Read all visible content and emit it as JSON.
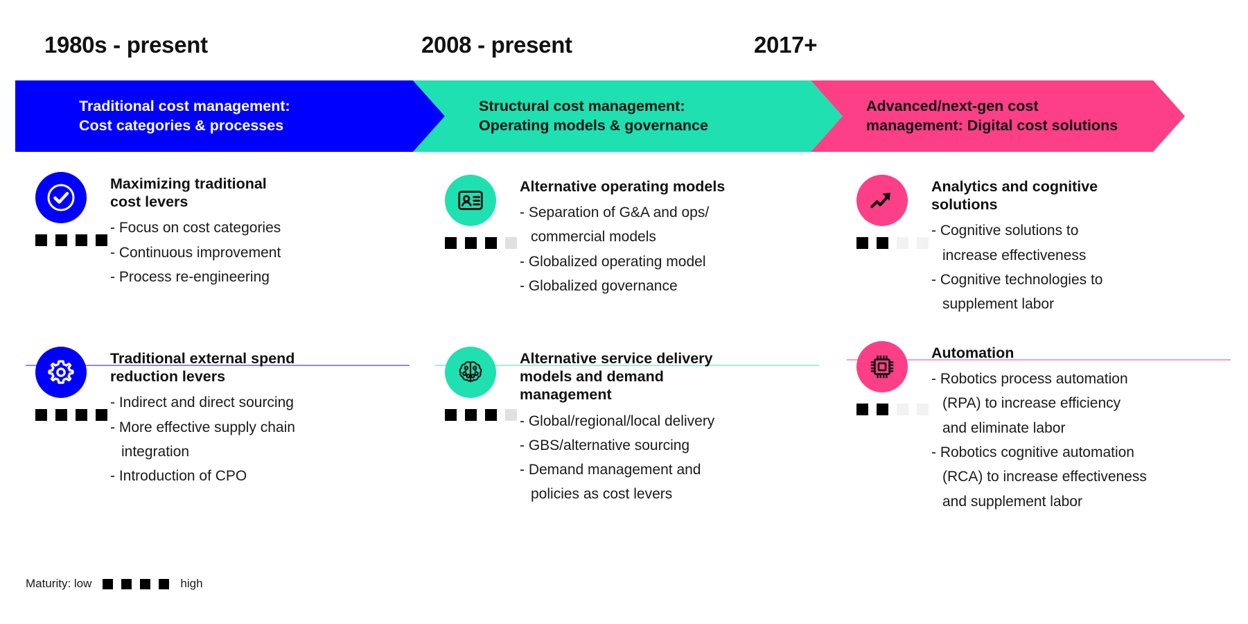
{
  "colors": {
    "blue": "#0000ff",
    "teal": "#1fe0b0",
    "pink": "#fc3f86",
    "maturity_filled": "#000000",
    "maturity_empty_teal": "#e0e0e0",
    "maturity_empty_pink": "#f2f2f2",
    "divider_blue": "#8a8aec",
    "divider_teal": "#a4ecd9",
    "divider_pink": "#f7a0bf"
  },
  "columns": [
    {
      "era": "1980s - present",
      "banner": "Traditional cost management:\nCost categories & processes",
      "banner_text_color": "#ffffff",
      "accent": "#0000ff",
      "blocks": [
        {
          "icon": "check-circle-icon",
          "title": "Maximizing traditional\ncost levers",
          "maturity_filled": 4,
          "maturity_total": 4,
          "bullets": [
            "- Focus on cost categories",
            "- Continuous improvement",
            "- Process re-engineering"
          ]
        },
        {
          "icon": "gear-icon",
          "title": "Traditional external spend\nreduction levers",
          "maturity_filled": 4,
          "maturity_total": 4,
          "bullets": [
            "- Indirect and direct sourcing",
            "- More effective supply chain\n  integration",
            "- Introduction of CPO"
          ]
        }
      ]
    },
    {
      "era": "2008 - present",
      "banner": "Structural cost management:\nOperating models & governance",
      "banner_text_color": "#111111",
      "accent": "#1fe0b0",
      "blocks": [
        {
          "icon": "id-card-icon",
          "title": "Alternative operating models",
          "maturity_filled": 3,
          "maturity_total": 4,
          "bullets": [
            "- Separation of G&A and ops/\n  commercial models",
            "- Globalized operating model",
            "- Globalized governance"
          ]
        },
        {
          "icon": "brain-circuit-icon",
          "title": "Alternative service delivery\nmodels and demand\nmanagement",
          "maturity_filled": 3,
          "maturity_total": 4,
          "bullets": [
            "- Global/regional/local delivery",
            "- GBS/alternative sourcing",
            "- Demand management and\n  policies as cost levers"
          ]
        }
      ]
    },
    {
      "era": "2017+",
      "banner": "Advanced/next-gen cost\nmanagement: Digital cost solutions",
      "banner_text_color": "#111111",
      "accent": "#fc3f86",
      "blocks": [
        {
          "icon": "trending-up-arrow-icon",
          "title": "Analytics and cognitive\nsolutions",
          "maturity_filled": 2,
          "maturity_total": 4,
          "bullets": [
            "- Cognitive solutions to\n   increase effectiveness",
            "- Cognitive technologies to\n   supplement labor"
          ]
        },
        {
          "icon": "cpu-chip-icon",
          "title": "Automation",
          "maturity_filled": 2,
          "maturity_total": 4,
          "bullets": [
            "- Robotics process automation\n  (RPA) to increase efficiency\n  and eliminate labor",
            "- Robotics cognitive automation\n  (RCA) to increase effectiveness\n  and supplement labor"
          ]
        }
      ]
    }
  ],
  "legend": {
    "prefix": "Maturity: low",
    "suffix": "high",
    "squares": 4
  }
}
